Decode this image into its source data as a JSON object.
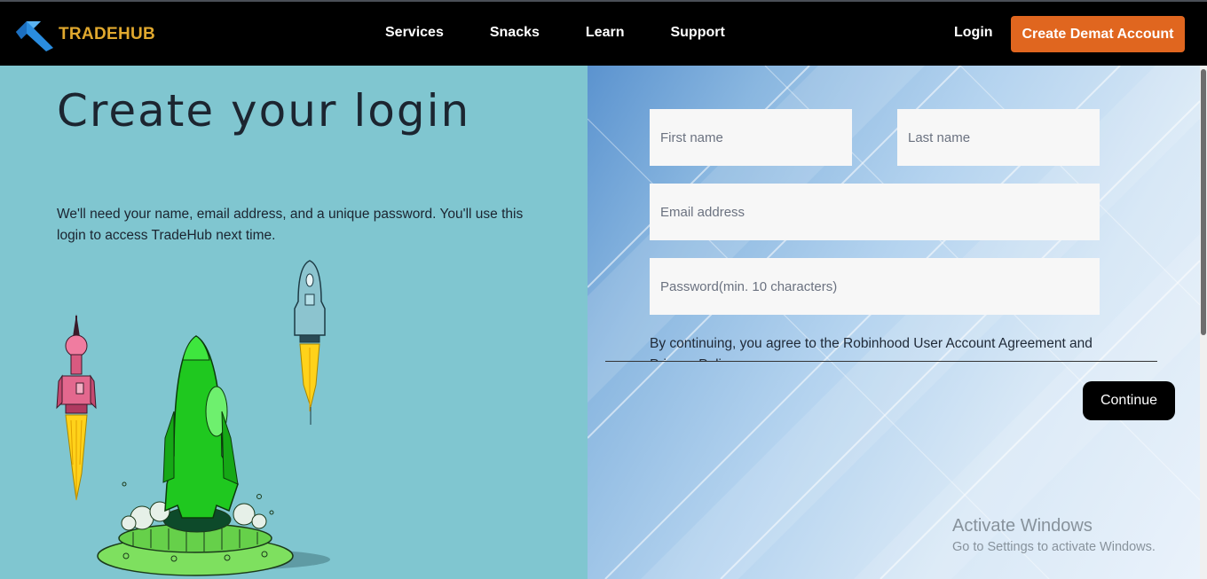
{
  "navbar": {
    "brand": "TRADEHUB",
    "links": [
      "Services",
      "Snacks",
      "Learn",
      "Support"
    ],
    "login": "Login",
    "cta": "Create Demat Account",
    "brand_color": "#e0a82e",
    "cta_color": "#e0661f"
  },
  "left": {
    "title": "Create your login",
    "description": "We'll need your name, email address, and a unique password. You'll use this login to access TradeHub next time.",
    "background": "#80c6d0"
  },
  "form": {
    "first_name_placeholder": "First name",
    "last_name_placeholder": "Last name",
    "email_placeholder": "Email address",
    "password_placeholder": "Password(min. 10 characters)",
    "agreement": "By continuing, you agree to the Robinhood User Account Agreement and Privacy Policy.",
    "continue": "Continue"
  },
  "watermark": {
    "line1": "Activate Windows",
    "line2": "Go to Settings to activate Windows."
  }
}
